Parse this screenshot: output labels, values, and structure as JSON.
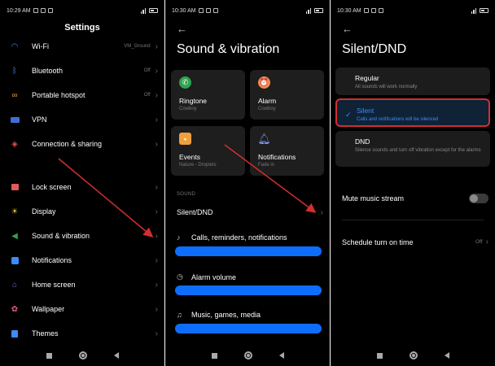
{
  "panel1": {
    "status": {
      "time": "10:29 AM"
    },
    "title": "Settings",
    "items": [
      {
        "icon": "wifi-icon",
        "label": "Wi-Fi",
        "value": "VM_Ground"
      },
      {
        "icon": "bluetooth-icon",
        "label": "Bluetooth",
        "value": "Off"
      },
      {
        "icon": "hotspot-icon",
        "label": "Portable hotspot",
        "value": "Off"
      },
      {
        "icon": "vpn-icon",
        "label": "VPN",
        "value": ""
      },
      {
        "icon": "connection-sharing-icon",
        "label": "Connection & sharing",
        "value": ""
      },
      {
        "icon": "lock-icon",
        "label": "Lock screen",
        "value": ""
      },
      {
        "icon": "display-icon",
        "label": "Display",
        "value": ""
      },
      {
        "icon": "sound-icon",
        "label": "Sound & vibration",
        "value": ""
      },
      {
        "icon": "notifications-icon",
        "label": "Notifications",
        "value": ""
      },
      {
        "icon": "home-icon",
        "label": "Home screen",
        "value": ""
      },
      {
        "icon": "wallpaper-icon",
        "label": "Wallpaper",
        "value": ""
      },
      {
        "icon": "themes-icon",
        "label": "Themes",
        "value": ""
      }
    ]
  },
  "panel2": {
    "status": {
      "time": "10:30 AM"
    },
    "title": "Sound & vibration",
    "tiles": [
      {
        "icon": "phone-icon",
        "label": "Ringtone",
        "sub": "Cowboy",
        "color": "#2ea44f"
      },
      {
        "icon": "alarm-icon",
        "label": "Alarm",
        "sub": "Cowboy",
        "color": "#f08a4b"
      },
      {
        "icon": "events-icon",
        "label": "Events",
        "sub": "Nature - Droplets",
        "color": "#f0a03c"
      },
      {
        "icon": "bell-icon",
        "label": "Notifications",
        "sub": "Fade in",
        "color": "#5b8def"
      }
    ],
    "section": "SOUND",
    "silent_dnd": "Silent/DND",
    "volumes": [
      {
        "icon": "bell-small-icon",
        "label": "Calls, reminders, notifications",
        "level": 1.0
      },
      {
        "icon": "alarm-small-icon",
        "label": "Alarm volume",
        "level": 1.0
      },
      {
        "icon": "music-icon",
        "label": "Music, games, media",
        "level": 1.0
      }
    ]
  },
  "panel3": {
    "status": {
      "time": "10:30 AM"
    },
    "title": "Silent/DND",
    "options": [
      {
        "label": "Regular",
        "sub": "All sounds will work normally",
        "selected": false
      },
      {
        "label": "Silent",
        "sub": "Calls and notifications will be silenced",
        "selected": true
      },
      {
        "label": "DND",
        "sub": "Silence sounds and turn off vibration except for the alarms",
        "selected": false
      }
    ],
    "mute_music": "Mute music stream",
    "schedule": "Schedule turn on time",
    "schedule_value": "Off"
  },
  "colors": {
    "accent": "#0d6efd",
    "highlight": "#d32f2f",
    "annotation_arrow": "#d32f2f"
  }
}
